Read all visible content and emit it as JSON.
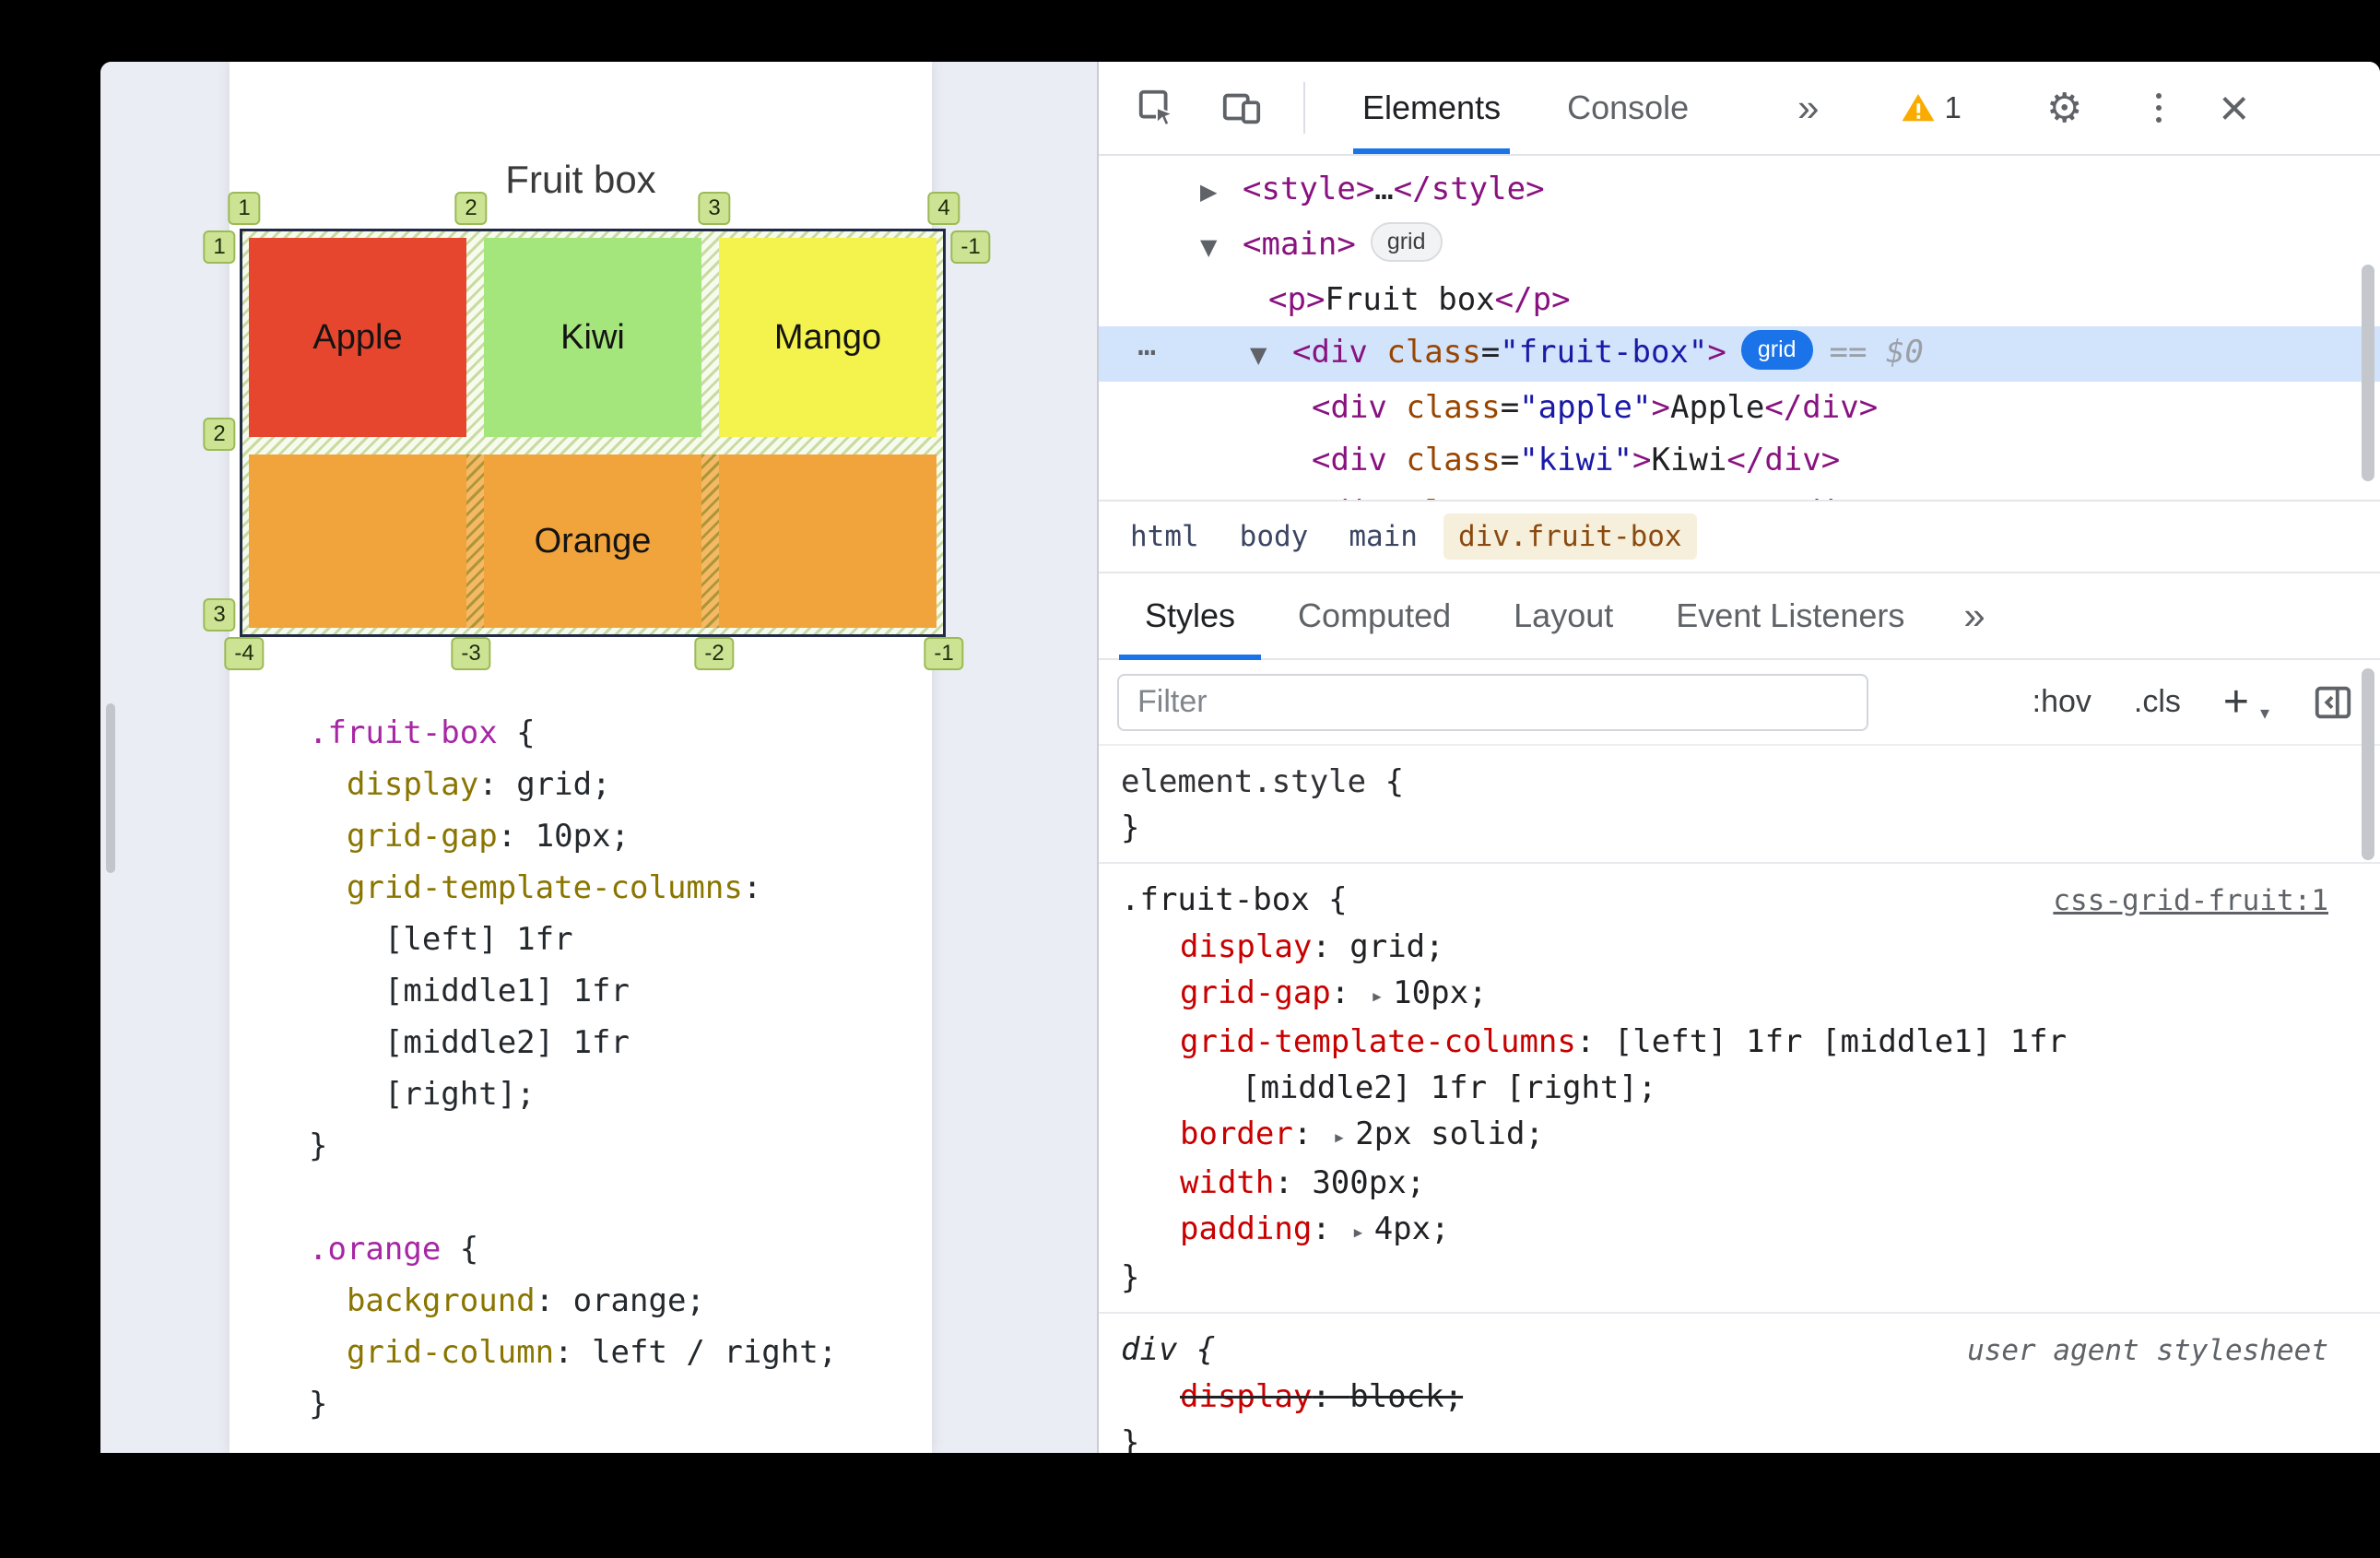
{
  "page": {
    "title": "Fruit box",
    "grid": {
      "cells": [
        {
          "label": "Apple",
          "color": "#e5462d"
        },
        {
          "label": "Kiwi",
          "color": "#a4e57c"
        },
        {
          "label": "Mango",
          "color": "#f4f24c"
        },
        {
          "label": "Orange",
          "color": "#f1a43c"
        }
      ],
      "line_badges": {
        "top": [
          "1",
          "2",
          "3",
          "4"
        ],
        "left": [
          "1",
          "2",
          "3"
        ],
        "right": [
          "-1"
        ],
        "bottom": [
          "-4",
          "-3",
          "-2",
          "-1"
        ]
      }
    },
    "code_lines": [
      [
        {
          "t": ".fruit-box",
          "c": "sel"
        },
        {
          "t": " {"
        }
      ],
      [
        {
          "t": "  "
        },
        {
          "t": "display",
          "c": "prop"
        },
        {
          "t": ": grid;"
        }
      ],
      [
        {
          "t": "  "
        },
        {
          "t": "grid-gap",
          "c": "prop"
        },
        {
          "t": ": 10px;"
        }
      ],
      [
        {
          "t": "  "
        },
        {
          "t": "grid-template-columns",
          "c": "prop"
        },
        {
          "t": ":"
        }
      ],
      [
        {
          "t": "    [left] 1fr"
        }
      ],
      [
        {
          "t": "    [middle1] 1fr"
        }
      ],
      [
        {
          "t": "    [middle2] 1fr"
        }
      ],
      [
        {
          "t": "    [right];"
        }
      ],
      [
        {
          "t": "}"
        }
      ],
      [],
      [
        {
          "t": ".orange",
          "c": "sel"
        },
        {
          "t": " {"
        }
      ],
      [
        {
          "t": "  "
        },
        {
          "t": "background",
          "c": "prop"
        },
        {
          "t": ": orange;"
        }
      ],
      [
        {
          "t": "  "
        },
        {
          "t": "grid-column",
          "c": "prop"
        },
        {
          "t": ": left / right;"
        }
      ],
      [
        {
          "t": "}"
        }
      ]
    ]
  },
  "devtools": {
    "toolbar": {
      "tabs": [
        {
          "label": "Elements",
          "selected": true
        },
        {
          "label": "Console",
          "selected": false
        }
      ],
      "more": "»",
      "warning_count": "1",
      "close": "×"
    },
    "dom_lines": [
      {
        "indent": 110,
        "arrow": "▶",
        "tokens": [
          {
            "t": "<style>",
            "c": "tag"
          },
          {
            "t": "…"
          },
          {
            "t": "</style>",
            "c": "tag"
          }
        ]
      },
      {
        "indent": 110,
        "arrow": "▼",
        "tokens": [
          {
            "t": "<main>",
            "c": "tag"
          },
          {
            "t": "grid",
            "c": "badge"
          }
        ]
      },
      {
        "indent": 184,
        "tokens": [
          {
            "t": "<p>",
            "c": "tag"
          },
          {
            "t": "Fruit box"
          },
          {
            "t": "</p>",
            "c": "tag"
          }
        ]
      },
      {
        "indent": 164,
        "arrow": "▼",
        "dots": "⋯",
        "selected": true,
        "tokens": [
          {
            "t": "<div ",
            "c": "tag"
          },
          {
            "t": "class",
            "c": "attr"
          },
          {
            "t": "="
          },
          {
            "t": "\"fruit-box\"",
            "c": "str"
          },
          {
            "t": ">",
            "c": "tag"
          },
          {
            "t": "grid",
            "c": "badgeblue"
          },
          {
            "t": "== $0",
            "c": "eq"
          }
        ]
      },
      {
        "indent": 231,
        "tokens": [
          {
            "t": "<div ",
            "c": "tag"
          },
          {
            "t": "class",
            "c": "attr"
          },
          {
            "t": "="
          },
          {
            "t": "\"apple\"",
            "c": "str"
          },
          {
            "t": ">",
            "c": "tag"
          },
          {
            "t": "Apple"
          },
          {
            "t": "</div>",
            "c": "tag"
          }
        ]
      },
      {
        "indent": 231,
        "tokens": [
          {
            "t": "<div ",
            "c": "tag"
          },
          {
            "t": "class",
            "c": "attr"
          },
          {
            "t": "="
          },
          {
            "t": "\"kiwi\"",
            "c": "str"
          },
          {
            "t": ">",
            "c": "tag"
          },
          {
            "t": "Kiwi"
          },
          {
            "t": "</div>",
            "c": "tag"
          }
        ]
      },
      {
        "indent": 231,
        "tokens": [
          {
            "t": "<div ",
            "c": "tag"
          },
          {
            "t": "class",
            "c": "attr"
          },
          {
            "t": "="
          },
          {
            "t": "\"mango\"",
            "c": "str"
          },
          {
            "t": ">",
            "c": "tag"
          },
          {
            "t": "Mango"
          },
          {
            "t": "</div>",
            "c": "tag"
          }
        ]
      }
    ],
    "crumbs": [
      {
        "label": "html"
      },
      {
        "label": "body"
      },
      {
        "label": "main"
      },
      {
        "label": "div.fruit-box",
        "selected": true
      }
    ],
    "panel_tabs": [
      {
        "label": "Styles",
        "selected": true
      },
      {
        "label": "Computed"
      },
      {
        "label": "Layout"
      },
      {
        "label": "Event Listeners"
      }
    ],
    "panel_more": "»",
    "filter": {
      "placeholder": "Filter",
      "pseudo": ":hov",
      "classes": ".cls",
      "plus": "+"
    },
    "style_rules": [
      {
        "selector_tokens": [
          {
            "t": "element.style",
            "c": "elemstyle"
          },
          {
            "t": " {"
          }
        ],
        "link": null,
        "prop_lines": [],
        "close": "}"
      },
      {
        "selector_tokens": [
          {
            "t": ".fruit-box"
          },
          {
            "t": " {"
          }
        ],
        "link": {
          "text": "css-grid-fruit:1",
          "underline": true
        },
        "prop_lines": [
          {
            "tokens": [
              {
                "t": "display",
                "c": "pn"
              },
              {
                "t": ": "
              },
              {
                "t": "grid;"
              }
            ]
          },
          {
            "tokens": [
              {
                "t": "grid-gap",
                "c": "pn"
              },
              {
                "t": ": "
              },
              {
                "t": "▸",
                "c": "exp"
              },
              {
                "t": "10px;"
              }
            ]
          },
          {
            "tokens": [
              {
                "t": "grid-template-columns",
                "c": "pn"
              },
              {
                "t": ": [left] 1fr [middle1] 1fr"
              }
            ]
          },
          {
            "indent": 131,
            "tokens": [
              {
                "t": "[middle2] 1fr [right];"
              }
            ]
          },
          {
            "tokens": [
              {
                "t": "border",
                "c": "pn"
              },
              {
                "t": ": "
              },
              {
                "t": "▸",
                "c": "exp"
              },
              {
                "t": "2px solid;"
              }
            ]
          },
          {
            "tokens": [
              {
                "t": "width",
                "c": "pn"
              },
              {
                "t": ": "
              },
              {
                "t": "300px;"
              }
            ]
          },
          {
            "tokens": [
              {
                "t": "padding",
                "c": "pn"
              },
              {
                "t": ": "
              },
              {
                "t": "▸",
                "c": "exp"
              },
              {
                "t": "4px;"
              }
            ]
          }
        ],
        "close": "}"
      },
      {
        "selector_tokens": [
          {
            "t": "div {",
            "c": "it"
          }
        ],
        "link": {
          "text": "user agent stylesheet",
          "italic": true
        },
        "prop_lines": [
          {
            "strike": true,
            "tokens": [
              {
                "t": "display",
                "c": "pn"
              },
              {
                "t": ": "
              },
              {
                "t": "block;"
              }
            ]
          }
        ],
        "close": "}"
      }
    ]
  }
}
